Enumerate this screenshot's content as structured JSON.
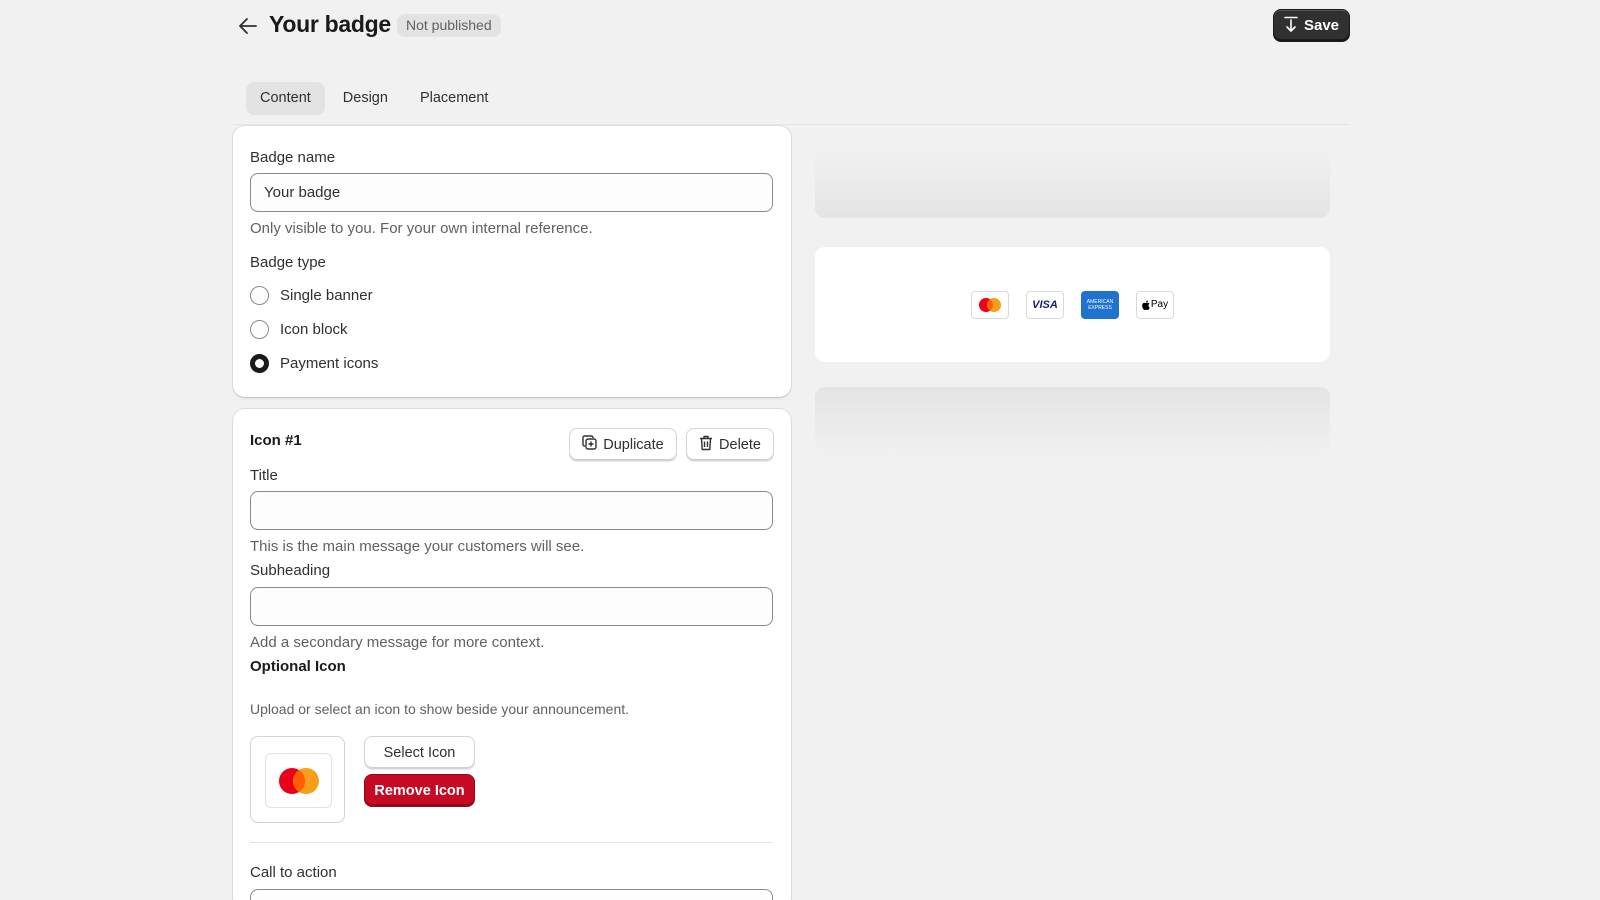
{
  "header": {
    "title": "Your badge",
    "status": "Not published",
    "save_label": "Save"
  },
  "tabs": [
    {
      "label": "Content",
      "active": true
    },
    {
      "label": "Design",
      "active": false
    },
    {
      "label": "Placement",
      "active": false
    }
  ],
  "badge_settings": {
    "name_label": "Badge name",
    "name_value": "Your badge",
    "name_help": "Only visible to you. For your own internal reference.",
    "type_label": "Badge type",
    "types": [
      {
        "label": "Single banner",
        "checked": false
      },
      {
        "label": "Icon block",
        "checked": false
      },
      {
        "label": "Payment icons",
        "checked": true
      }
    ]
  },
  "icon_item": {
    "heading": "Icon #1",
    "duplicate_label": "Duplicate",
    "delete_label": "Delete",
    "title_label": "Title",
    "title_value": "",
    "title_help": "This is the main message your customers will see.",
    "subheading_label": "Subheading",
    "subheading_value": "",
    "subheading_help": "Add a secondary message for more context.",
    "optional_icon_label": "Optional Icon",
    "optional_icon_help": "Upload or select an icon to show beside your announcement.",
    "selected_icon": "mastercard-icon",
    "select_icon_label": "Select Icon",
    "remove_icon_label": "Remove Icon",
    "cta_label": "Call to action"
  },
  "preview": {
    "payment_icons": [
      "mastercard-icon",
      "visa-icon",
      "amex-icon",
      "apple-pay-icon"
    ],
    "visa_text": "VISA",
    "amex_text": "AMERICAN EXPRESS",
    "applepay_text": "Pay"
  },
  "colors": {
    "primary_button": "#303030",
    "critical_button": "#c70a24",
    "background": "#f1f1f1"
  }
}
